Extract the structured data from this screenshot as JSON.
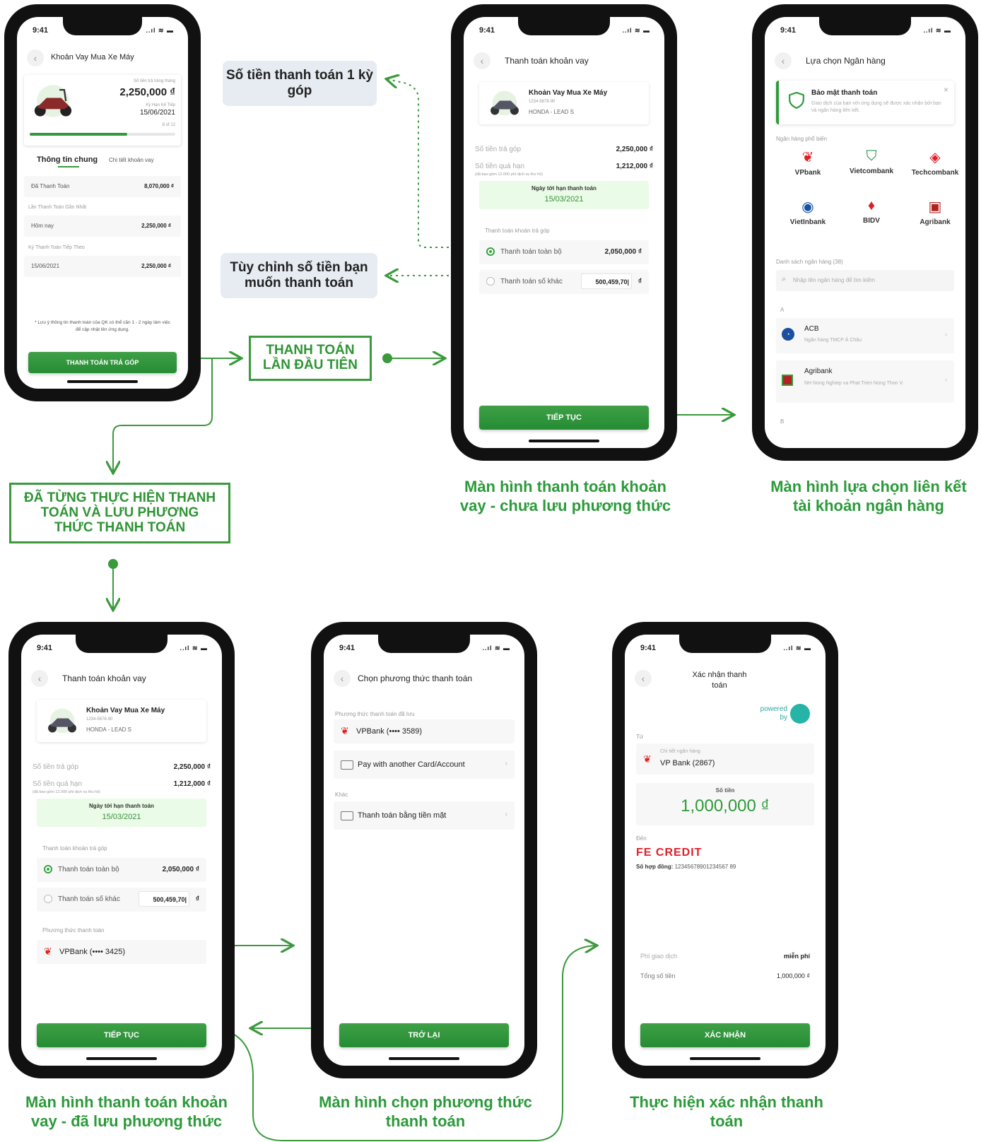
{
  "status": {
    "time": "9:41",
    "signal": "..ıl ≋ ▬"
  },
  "callouts": {
    "amount_one": "Số tiền thanh toán 1 kỳ góp",
    "custom_amount": "Tùy chỉnh số tiền bạn muốn thanh toán"
  },
  "boxes": {
    "first_time": "THANH TOÁN LẦN ĐẦU TIÊN",
    "saved": "ĐÃ TỪNG THỰC HIỆN THANH TOÁN VÀ LƯU PHƯƠNG THỨC THANH TOÁN"
  },
  "captions": {
    "pay_not_saved": "Màn hình thanh toán khoản vay - chưa lưu phương thức",
    "bank_select": "Màn hình lựa chọn liên kết tài khoản ngân hàng",
    "pay_saved": "Màn hình thanh toán khoản vay - đã lưu phương thức",
    "choose_method": "Màn hình chọn phương thức thanh toán",
    "confirm": "Thực hiện xác nhận thanh toán"
  },
  "screen1": {
    "title": "Khoản Vay Mua Xe Máy",
    "monthly_label": "Số tiền trả hàng tháng",
    "amount": "2,250,000 ₫",
    "next_label": "Kỳ Hạn Kế Tiếp",
    "next_date": "15/06/2021",
    "progress_text": "8 of 12",
    "progress": 0.67,
    "tab_general": "Thông tin chung",
    "tab_detail": "Chi tiết khoản vay",
    "paid_label": "Đã Thanh Toán",
    "paid_value": "8,070,000 ₫",
    "recent_label": "Lần Thanh Toán Gần Nhất",
    "today_label": "Hôm nay",
    "today_value": "2,250,000 ₫",
    "next_pay_label": "Kỳ Thanh Toán Tiếp Theo",
    "next_pay_date": "15/06/2021",
    "next_pay_value": "2,250,000 ₫",
    "note": "* Lưu ý thông tin thanh toán của QK có thể cần 1 - 2 ngày làm việc để cập nhật lên ứng dụng.",
    "button": "THANH TOÁN TRẢ GÓP"
  },
  "pay": {
    "title": "Thanh toán khoản vay",
    "loan_name": "Khoản Vay Mua Xe Máy",
    "loan_no": "1234-5678-90",
    "loan_product": "HONDA - LEAD S",
    "installment_label": "Số tiền trả góp",
    "installment_value": "2,250,000 ₫",
    "overdue_label": "Số tiền quá hạn",
    "overdue_note": "(đã bao gồm 12.000 phí dịch vụ thu hộ)",
    "overdue_value": "1,212,000 ₫",
    "due_label": "Ngày tới hạn thanh toán",
    "due_date": "15/03/2021",
    "options_label": "Thanh toán khoản trả góp",
    "opt_full": "Thanh toán toàn bộ",
    "opt_full_value": "2,050,000 ₫",
    "opt_other": "Thanh toán số khác",
    "opt_other_value": "500,459,70|",
    "currency": "₫",
    "method_label": "Phương thức thanh toán",
    "method_value": "VPBank (•••• 3425)",
    "button": "TIẾP TỤC"
  },
  "bank": {
    "title": "Lựa chọn Ngân hàng",
    "security_title": "Bảo mật thanh toán",
    "security_text": "Giao dịch của bạn với ứng dụng sẽ được xác nhận bởi bạn và ngân hàng liên kết.",
    "popular_label": "Ngân hàng phổ biến",
    "banks": [
      "VPbank",
      "Vietcombank",
      "Techcombank",
      "VietInbank",
      "BIDV",
      "Agribank"
    ],
    "list_label": "Danh sách ngân hàng (38)",
    "search_placeholder": "Nhập tên ngân hàng để tìm kiếm",
    "letter_a": "A",
    "letter_b": "B",
    "acb_name": "ACB",
    "acb_full": "Ngân hàng TMCP Á Châu",
    "agri_name": "Agribank",
    "agri_full": "NH Nong Nghiep va Phat Trien Nong Thon V."
  },
  "method": {
    "title": "Chọn phương thức thanh toán",
    "saved_label": "Phương thức thanh toán đã lưu",
    "saved_item": "VPBank (•••• 3589)",
    "another": "Pay with another Card/Account",
    "other_label": "Khác",
    "cash": "Thanh toán bằng tiền mặt",
    "button": "TRỞ LẠI"
  },
  "confirm": {
    "title": "Xác nhận thanh toán",
    "powered": "powered by",
    "from_label": "Từ",
    "bank_detail_label": "Chi tiết ngân hàng",
    "bank_value": "VP Bank (2867)",
    "amount_label": "Số tiền",
    "amount": "1,000,000 ₫",
    "to_label": "Đến",
    "brand": "FE CREDIT",
    "contract_label": "Số hợp đồng:",
    "contract_no": "12345678901234567 89",
    "fee_label": "Phí giao dịch",
    "fee_value": "miễn phí",
    "total_label": "Tổng số tiền",
    "total_value": "1,000,000 ₫",
    "button": "XÁC NHẬN"
  }
}
